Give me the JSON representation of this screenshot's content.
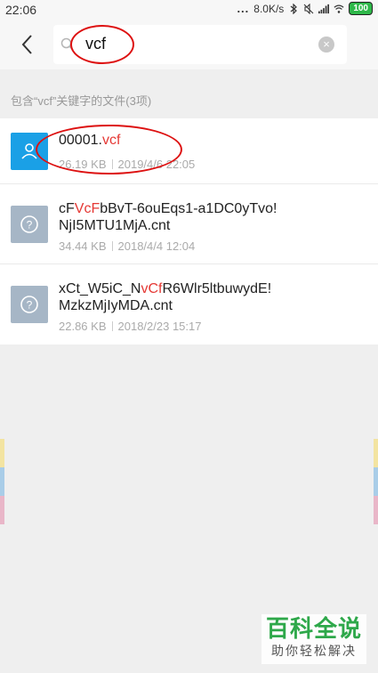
{
  "status_bar": {
    "time": "22:06",
    "dots": "...",
    "net_speed": "8.0K/s",
    "battery": "100",
    "icons": [
      "bluetooth-icon",
      "mute-icon",
      "signal-icon",
      "wifi-icon",
      "battery-icon"
    ]
  },
  "search": {
    "query": "vcf",
    "back_icon": "chevron-left-icon",
    "search_icon": "magnifier-icon",
    "clear_icon": "clear-icon",
    "clear_glyph": "×"
  },
  "section_label": "包含“vcf”关键字的文件(3项)",
  "results": [
    {
      "name_parts": [
        "00001.",
        "vcf",
        ""
      ],
      "name_line2": "",
      "size": "26.19 KB",
      "date": "2019/4/6 22:05",
      "icon": "contact-file-icon"
    },
    {
      "name_parts": [
        "cF",
        "VcF",
        "bBvT-6ouEqs1-a1DC0yTvo!"
      ],
      "name_line2": "NjI5MTU1MjA.cnt",
      "size": "34.44 KB",
      "date": "2018/4/4 12:04",
      "icon": "unknown-file-icon"
    },
    {
      "name_parts": [
        "xCt_W5iC_N",
        "vCf",
        "R6Wlr5ltbuwydE!"
      ],
      "name_line2": "MzkzMjIyMDA.cnt",
      "size": "22.86 KB",
      "date": "2018/2/23 15:17",
      "icon": "unknown-file-icon"
    }
  ],
  "colors": {
    "highlight": "#e53935",
    "annotation": "#dd1111",
    "contact_icon_bg": "#1aa0e6",
    "unknown_icon_bg": "#a6b6c6",
    "watermark_green": "#2ea84a"
  },
  "watermark": {
    "title": "百科全说",
    "subtitle": "助你轻松解决"
  }
}
